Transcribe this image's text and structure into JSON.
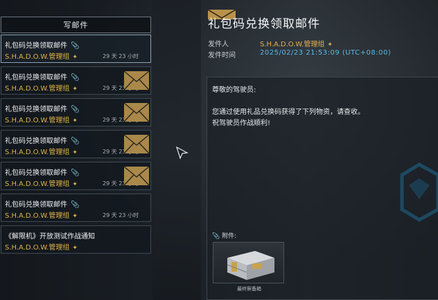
{
  "sidebar": {
    "compose_label": "写邮件",
    "mails": [
      {
        "title": "礼包码兑换领取邮件",
        "has_attachment": true,
        "sender": "S.H.A.D.O.W.管理组",
        "time": "29 天 23 小时",
        "selected": true,
        "envelope": false
      },
      {
        "title": "礼包码兑换领取邮件",
        "has_attachment": true,
        "sender": "S.H.A.D.O.W.管理组",
        "time": "29 天 23 小时",
        "selected": false,
        "envelope": true
      },
      {
        "title": "礼包码兑换领取邮件",
        "has_attachment": true,
        "sender": "S.H.A.D.O.W.管理组",
        "time": "29 天 23 小时",
        "selected": false,
        "envelope": true
      },
      {
        "title": "礼包码兑换领取邮件",
        "has_attachment": true,
        "sender": "S.H.A.D.O.W.管理组",
        "time": "29 天 23 小时",
        "selected": false,
        "envelope": true
      },
      {
        "title": "礼包码兑换领取邮件",
        "has_attachment": true,
        "sender": "S.H.A.D.O.W.管理组",
        "time": "29 天 23 小时",
        "selected": false,
        "envelope": true
      },
      {
        "title": "礼包码兑换领取邮件",
        "has_attachment": true,
        "sender": "S.H.A.D.O.W.管理组",
        "time": "29 天 23 小时",
        "selected": false,
        "envelope": false
      },
      {
        "title": "《解限机》开放测试作战通知",
        "has_attachment": false,
        "sender": "S.H.A.D.O.W.管理组",
        "time": "",
        "selected": false,
        "envelope": false
      }
    ]
  },
  "mail": {
    "title": "礼包码兑换领取邮件",
    "sender_label": "发件人",
    "sender": "S.H.A.D.O.W.管理组",
    "time_label": "发件时间",
    "time": "2025/02/23  21:53:09  (UTC+08:00)",
    "body": [
      "尊敬的驾驶员:",
      "您通过使用礼品兑换码获得了下列物资，请查收。",
      "祝驾驶员作战顺利!"
    ],
    "attachment_label": "附件:",
    "attachment_item": "最终察备箱"
  },
  "colors": {
    "accent_gold": "#e0b34a",
    "accent_blue": "#59b9e6"
  },
  "icons": {
    "attachment": "paperclip-icon",
    "badge": "winged-badge-icon",
    "envelope": "envelope-icon"
  }
}
